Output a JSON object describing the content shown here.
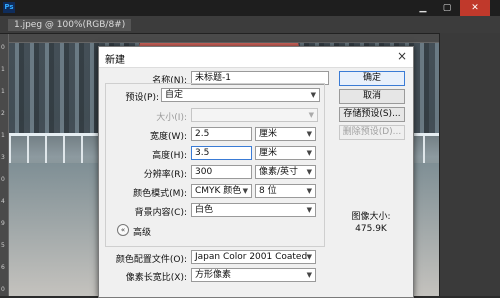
{
  "app": {
    "logo_text": "Ps",
    "window_controls": {
      "minimize": "▁",
      "maximize": "▢",
      "close": "✕"
    },
    "document_tab": "1.jpeg @ 100%(RGB/8#)",
    "ruler_numbers": [
      "0",
      "1",
      "1",
      "2",
      "1",
      "3",
      "0",
      "4",
      "9",
      "5",
      "6",
      "0"
    ]
  },
  "dialog": {
    "title": "新建",
    "close_glyph": "×",
    "fields": {
      "name": {
        "label": "名称(N):",
        "value": "未标题-1"
      },
      "preset": {
        "label": "预设(P):",
        "value": "自定"
      },
      "size": {
        "label": "大小(I):",
        "value": ""
      },
      "width": {
        "label": "宽度(W):",
        "value": "2.5",
        "unit": "厘米"
      },
      "height": {
        "label": "高度(H):",
        "value": "3.5",
        "unit": "厘米"
      },
      "resolution": {
        "label": "分辨率(R):",
        "value": "300",
        "unit": "像素/英寸"
      },
      "color_mode": {
        "label": "颜色模式(M):",
        "value": "CMYK 颜色",
        "depth": "8 位"
      },
      "background": {
        "label": "背景内容(C):",
        "value": "白色"
      }
    },
    "advanced": {
      "toggle_glyph": "«",
      "label": "高级",
      "color_profile": {
        "label": "颜色配置文件(O):",
        "value": "Japan Color 2001 Coated"
      },
      "pixel_aspect": {
        "label": "像素长宽比(X):",
        "value": "方形像素"
      }
    },
    "buttons": {
      "ok": "确定",
      "cancel": "取消",
      "save_preset": "存储预设(S)...",
      "delete_preset": "删除预设(D)..."
    },
    "image_size": {
      "label": "图像大小:",
      "value": "475.9K"
    }
  }
}
